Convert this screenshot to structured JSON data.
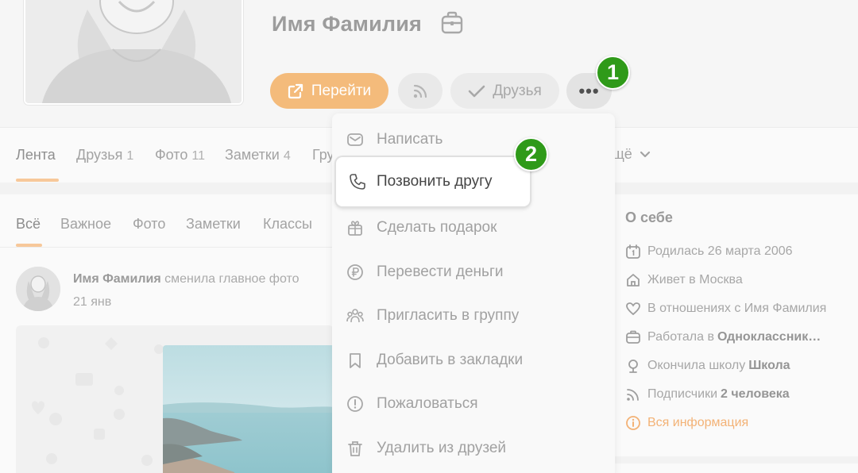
{
  "profile": {
    "name": "Имя Фамилия",
    "actions": {
      "go_label": "Перейти",
      "friends_label": "Друзья",
      "more_label": "•••"
    }
  },
  "badges": {
    "first": "1",
    "second": "2"
  },
  "profile_tabs": [
    {
      "label": "Лента",
      "count": ""
    },
    {
      "label": "Друзья",
      "count": "1"
    },
    {
      "label": "Фото",
      "count": "11"
    },
    {
      "label": "Заметки",
      "count": "4"
    },
    {
      "label": "Гру",
      "count": ""
    }
  ],
  "profile_tabs_more": "щё",
  "feed": {
    "tabs": [
      "Всё",
      "Важное",
      "Фото",
      "Заметки",
      "Классы"
    ],
    "post": {
      "author": "Имя Фамилия",
      "action": "сменила главное фото",
      "date": "21 янв"
    }
  },
  "about": {
    "title": "О себе",
    "born": "Родилась 26 марта 2006",
    "lives": "Живет в Москва",
    "relationship": "В отношениях с Имя Фамилия",
    "work_prefix": "Работала в",
    "work_place": "Одноклассник…",
    "school_prefix": "Окончила школу",
    "school_name": "Школа",
    "followers_prefix": "Подписчики",
    "followers_count": "2 человека",
    "all_info": "Вся информация"
  },
  "menu": {
    "items": [
      {
        "label": "Написать",
        "icon": "envelope-icon"
      },
      {
        "label": "Позвонить другу",
        "icon": "phone-icon"
      },
      {
        "label": "Сделать подарок",
        "icon": "gift-icon"
      },
      {
        "label": "Перевести деньги",
        "icon": "ruble-icon"
      },
      {
        "label": "Пригласить в группу",
        "icon": "group-icon"
      },
      {
        "label": "Добавить в закладки",
        "icon": "bookmark-icon"
      },
      {
        "label": "Пожаловаться",
        "icon": "warning-icon"
      },
      {
        "label": "Удалить из друзей",
        "icon": "trash-icon"
      }
    ]
  },
  "colors": {
    "accent_orange": "#f4bb7b",
    "badge_green": "#2f9a19",
    "link_orange": "#f3b276"
  }
}
